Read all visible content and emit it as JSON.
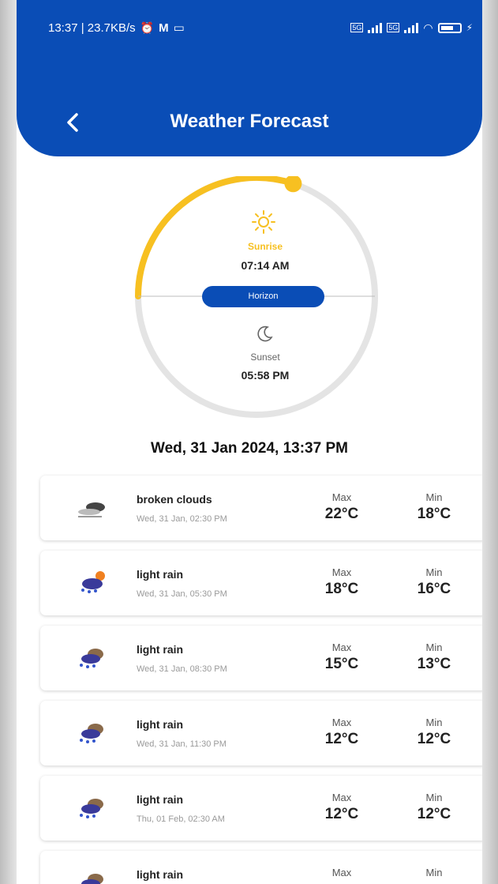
{
  "status_bar": {
    "time_speed": "13:37 | 23.7KB/s",
    "battery": "80"
  },
  "header": {
    "title": "Weather Forecast"
  },
  "sun": {
    "sunrise_label": "Sunrise",
    "sunrise_time": "07:14 AM",
    "horizon_label": "Horizon",
    "sunset_label": "Sunset",
    "sunset_time": "05:58 PM",
    "day_progress": 0.6
  },
  "current_datetime": "Wed, 31 Jan 2024, 13:37 PM",
  "forecast": {
    "max_label": "Max",
    "min_label": "Min",
    "items": [
      {
        "condition": "broken clouds",
        "time": "Wed, 31 Jan, 02:30 PM",
        "max": "22°C",
        "min": "18°C",
        "icon": "broken-clouds-icon"
      },
      {
        "condition": "light rain",
        "time": "Wed, 31 Jan, 05:30 PM",
        "max": "18°C",
        "min": "16°C",
        "icon": "light-rain-sun-icon"
      },
      {
        "condition": "light rain",
        "time": "Wed, 31 Jan, 08:30 PM",
        "max": "15°C",
        "min": "13°C",
        "icon": "light-rain-icon"
      },
      {
        "condition": "light rain",
        "time": "Wed, 31 Jan, 11:30 PM",
        "max": "12°C",
        "min": "12°C",
        "icon": "light-rain-icon"
      },
      {
        "condition": "light rain",
        "time": "Thu, 01 Feb, 02:30 AM",
        "max": "12°C",
        "min": "12°C",
        "icon": "light-rain-icon"
      },
      {
        "condition": "light rain",
        "time": "",
        "max": "",
        "min": "",
        "icon": "light-rain-icon"
      }
    ]
  },
  "colors": {
    "brand": "#0a4db6",
    "sun_arc": "#f7c021",
    "arc_track": "#e4e4e4"
  }
}
